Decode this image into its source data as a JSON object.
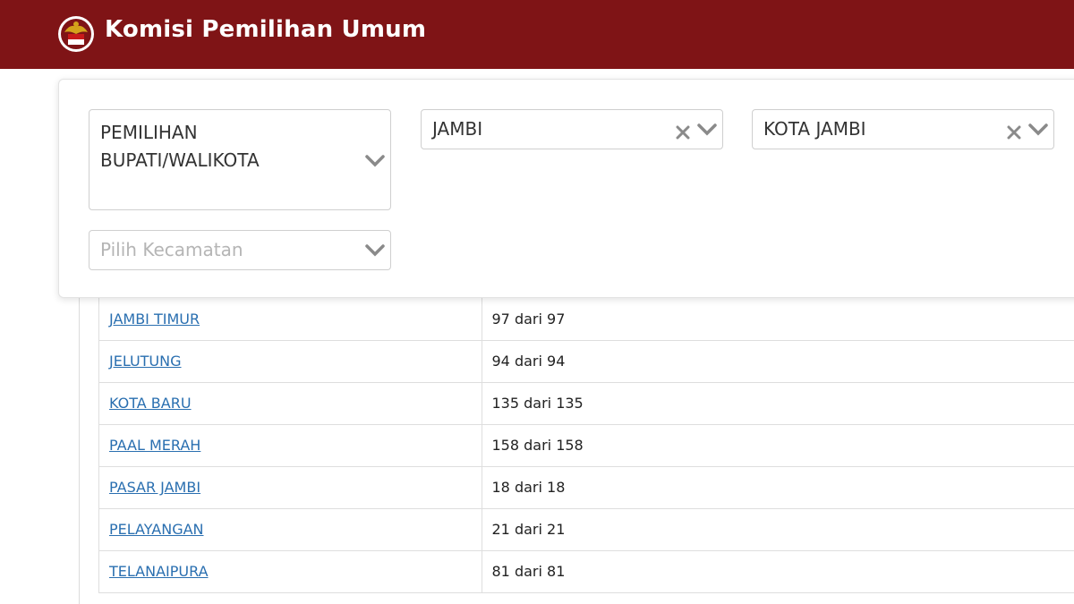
{
  "header": {
    "title": "Komisi Pemilihan Umum",
    "logo_icon": "kpu-logo-icon",
    "background": "#7f1416"
  },
  "filters": {
    "election_type": {
      "value": "PEMILIHAN BUPATI/WALIKOTA"
    },
    "province": {
      "value": "JAMBI"
    },
    "city": {
      "value": "KOTA JAMBI"
    },
    "district": {
      "placeholder": "Pilih Kecamatan"
    }
  },
  "table": {
    "rows": [
      {
        "name": "JAMBI TIMUR",
        "count": "97 dari 97"
      },
      {
        "name": "JELUTUNG",
        "count": "94 dari 94"
      },
      {
        "name": "KOTA BARU",
        "count": "135 dari 135"
      },
      {
        "name": "PAAL MERAH",
        "count": "158 dari 158"
      },
      {
        "name": "PASAR JAMBI",
        "count": "18 dari 18"
      },
      {
        "name": "PELAYANGAN",
        "count": "21 dari 21"
      },
      {
        "name": "TELANAIPURA",
        "count": "81 dari 81"
      }
    ]
  },
  "colors": {
    "link": "#2a6fb0",
    "border": "#dedede"
  }
}
